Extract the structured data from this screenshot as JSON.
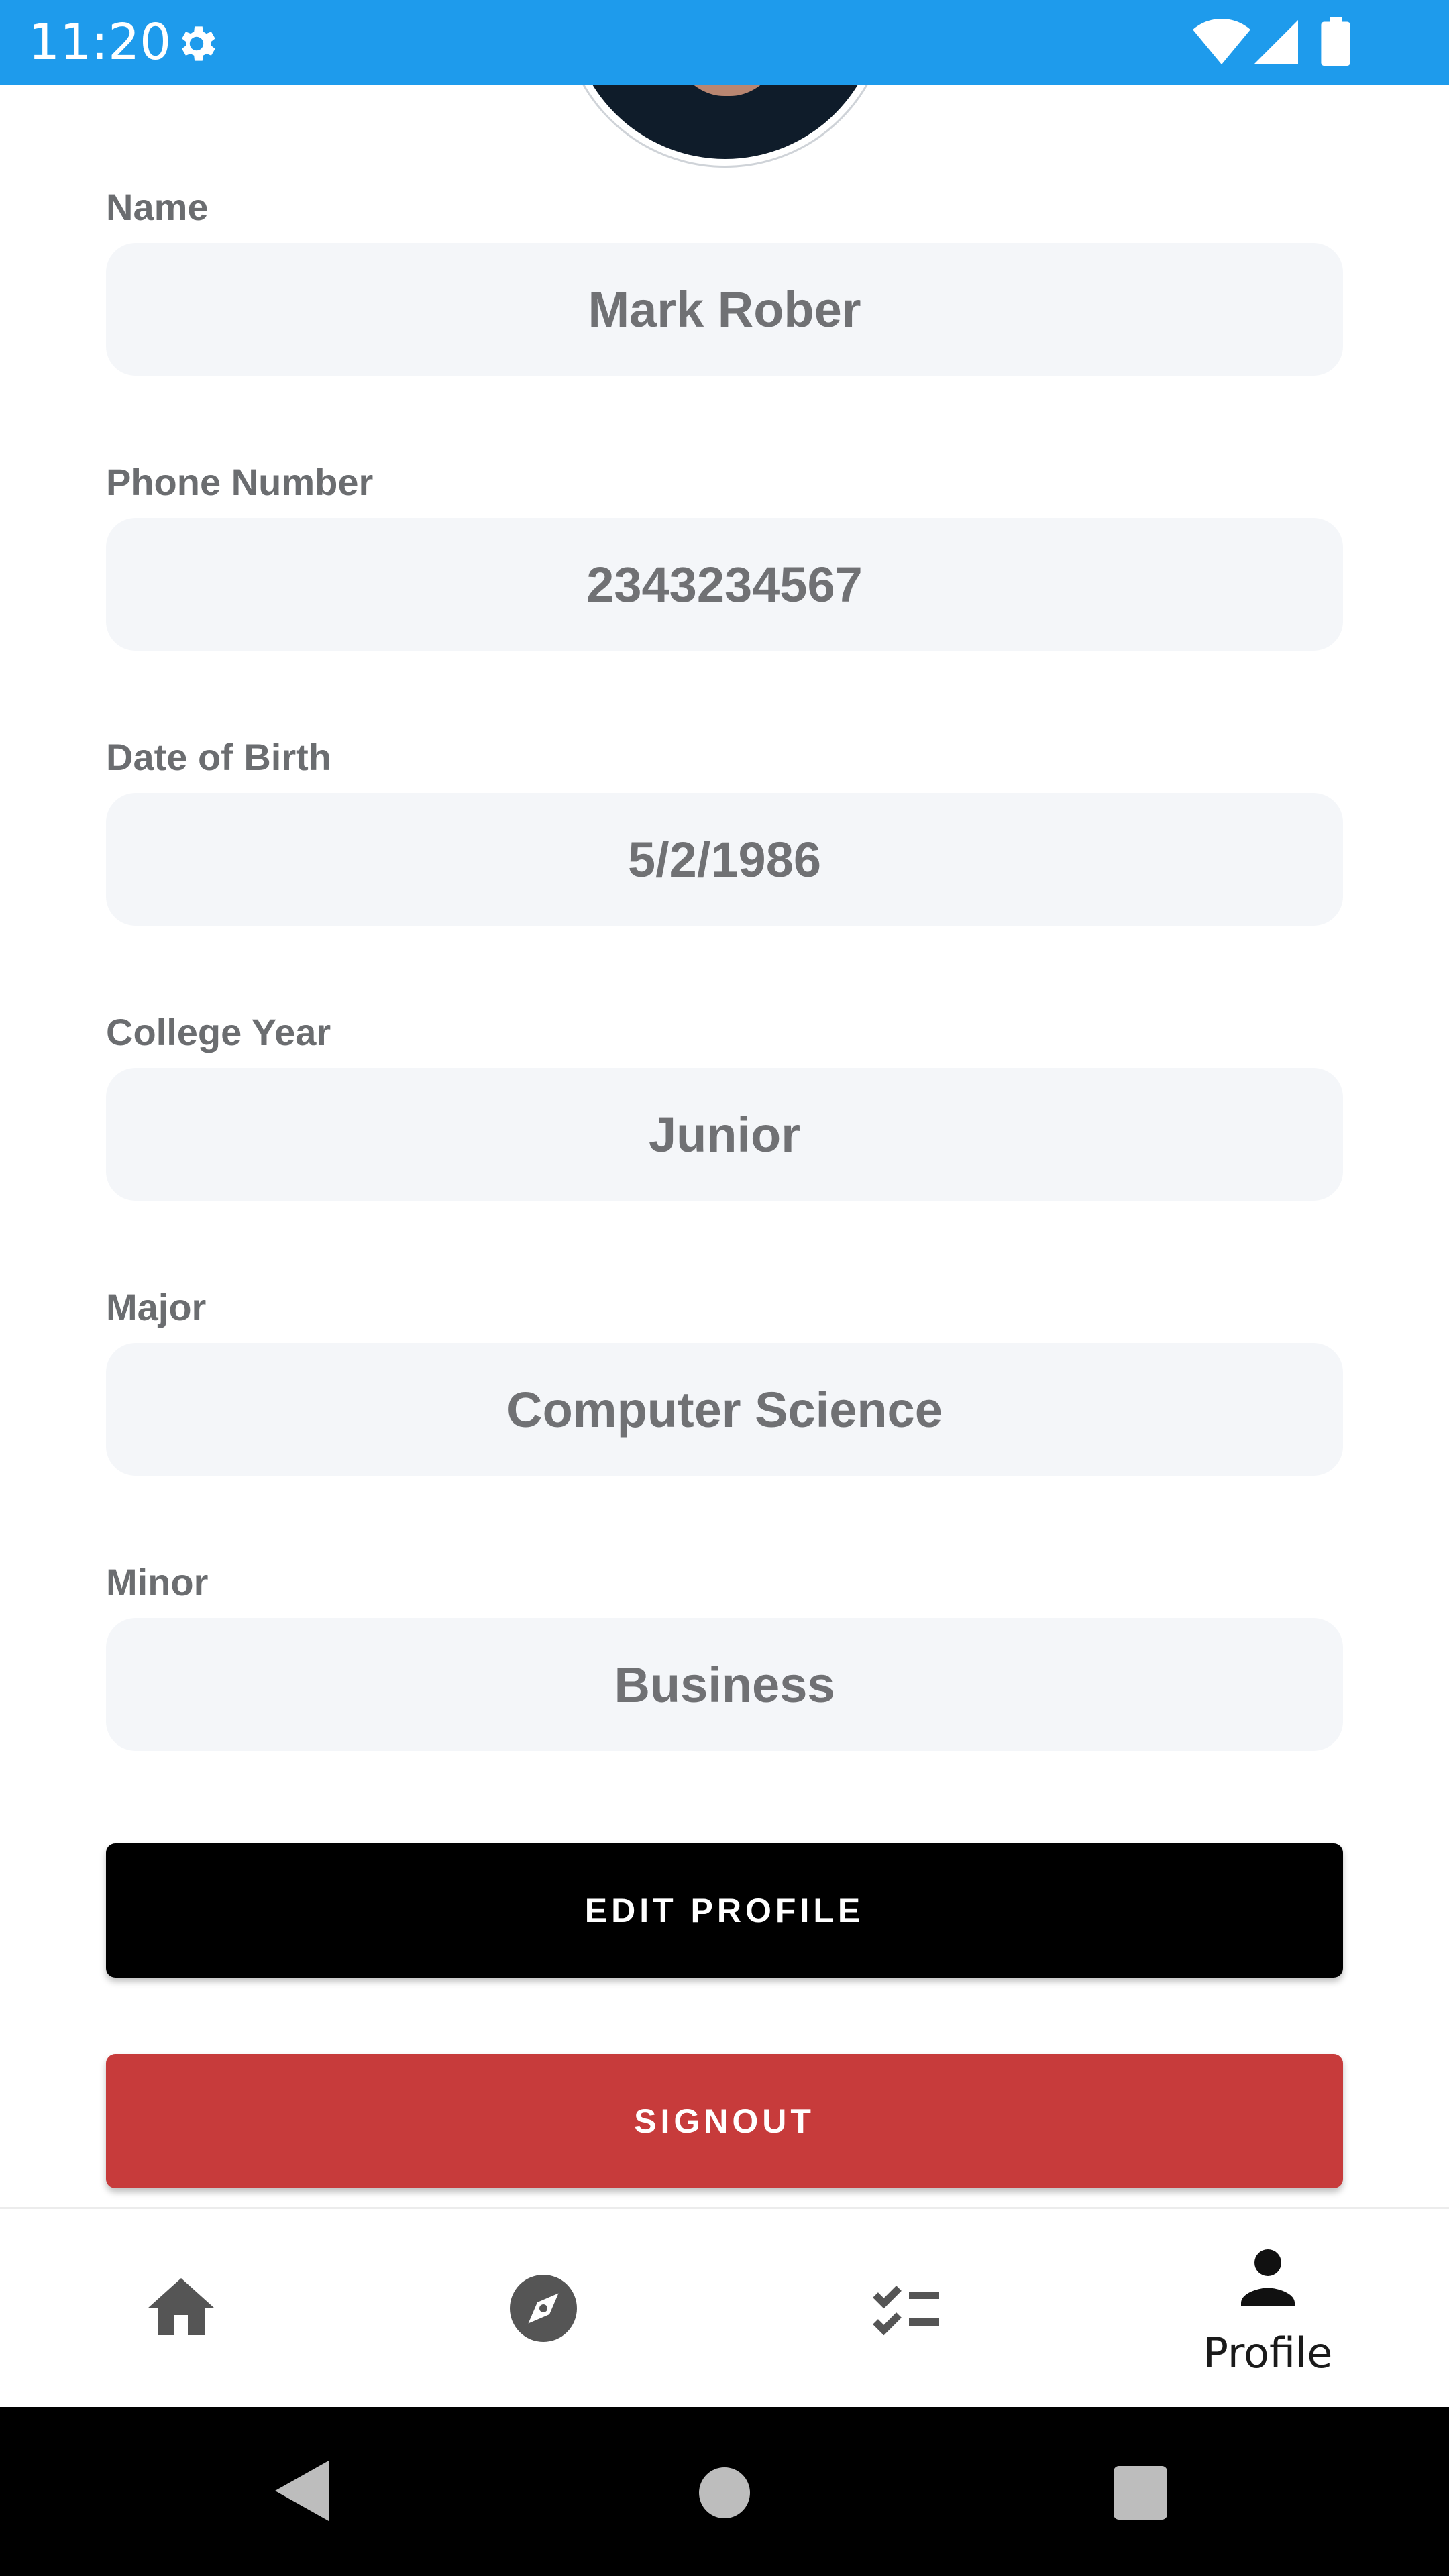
{
  "status_bar": {
    "time": "11:20",
    "background_color": "#1e9bec",
    "icons": [
      "gear-icon",
      "wifi-icon",
      "signal-icon",
      "battery-icon"
    ]
  },
  "profile": {
    "avatar": "avatar-photo",
    "fields": [
      {
        "label": "Name",
        "value": "Mark Rober"
      },
      {
        "label": "Phone Number",
        "value": "2343234567"
      },
      {
        "label": "Date of Birth",
        "value": "5/2/1986"
      },
      {
        "label": "College Year",
        "value": "Junior"
      },
      {
        "label": "Major",
        "value": "Computer Science"
      },
      {
        "label": "Minor",
        "value": "Business"
      }
    ],
    "edit_button_label": "EDIT PROFILE",
    "signout_button_label": "SIGNOUT",
    "signout_color": "#c73b3b"
  },
  "bottom_nav": {
    "items": [
      {
        "icon": "home-icon",
        "label": ""
      },
      {
        "icon": "compass-icon",
        "label": ""
      },
      {
        "icon": "checklist-icon",
        "label": ""
      },
      {
        "icon": "person-icon",
        "label": "Profile"
      }
    ],
    "active": "Profile"
  },
  "system_nav": {
    "icons": [
      "back-icon",
      "home-circle-icon",
      "recents-icon"
    ]
  }
}
